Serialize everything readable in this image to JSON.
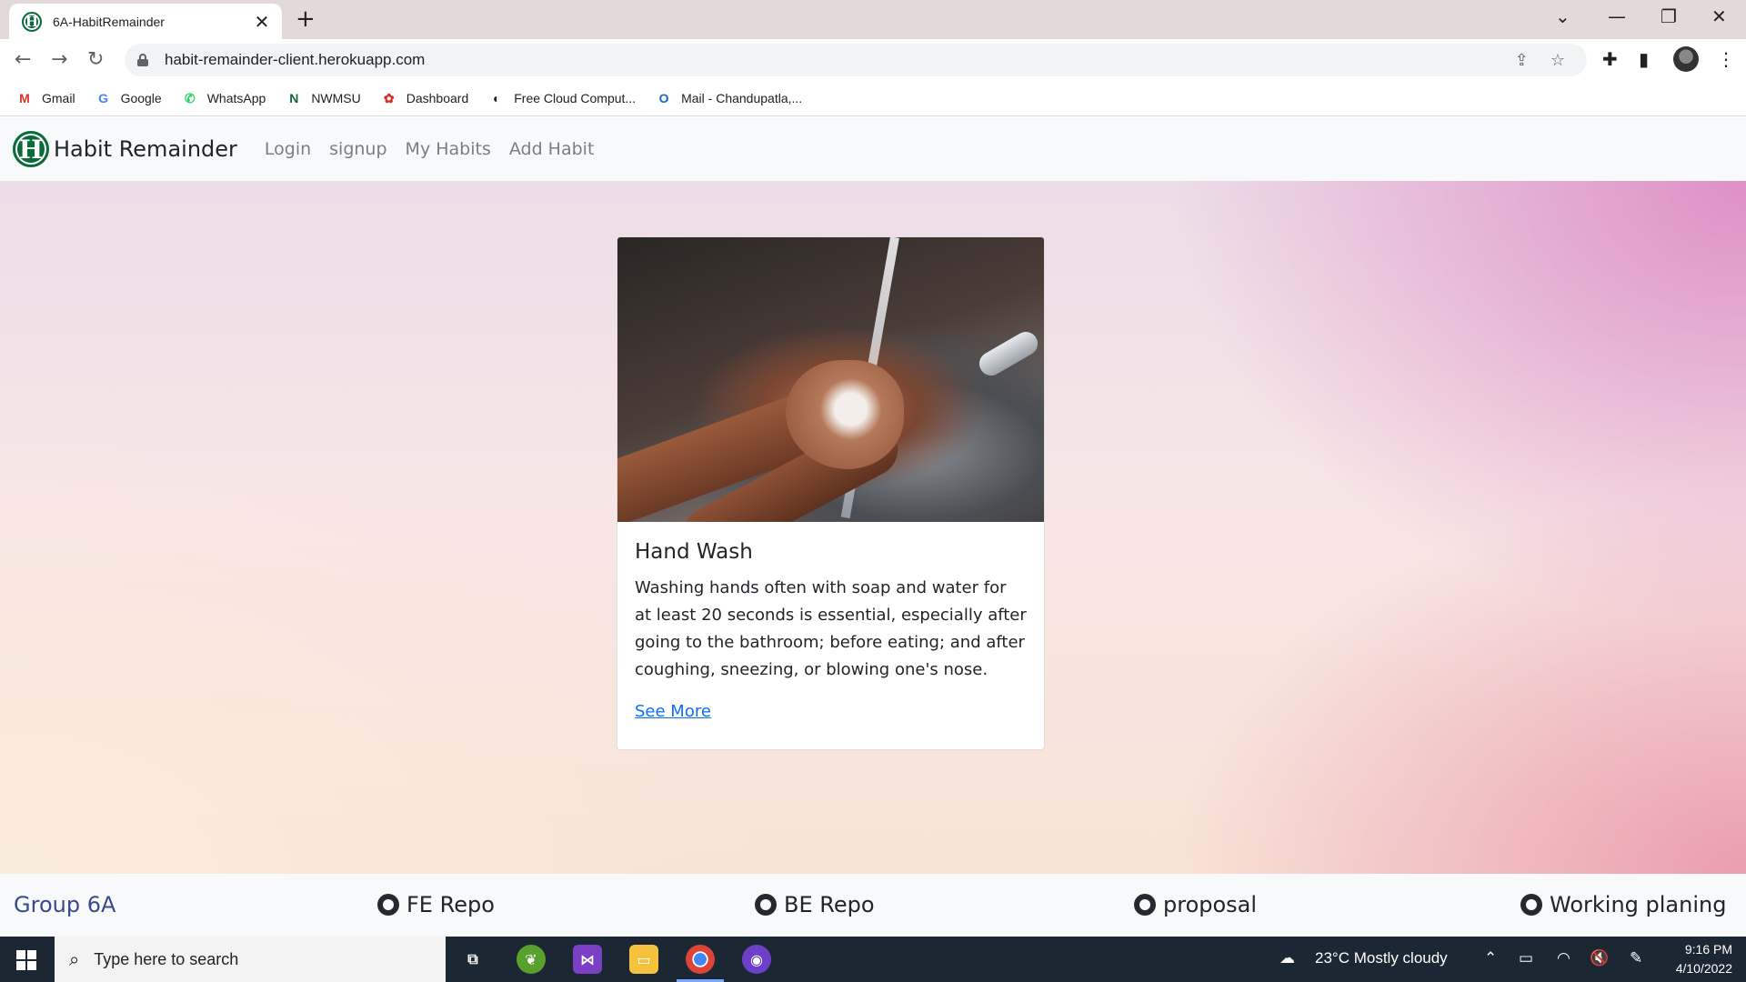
{
  "browser": {
    "tab_title": "6A-HabitRemainder",
    "tab_close": "✕",
    "new_tab": "+",
    "url": "habit-remainder-client.herokuapp.com",
    "bookmarks": [
      {
        "label": "Gmail",
        "icon": "gmail-icon",
        "glyph": "M",
        "color": "#d93025"
      },
      {
        "label": "Google",
        "icon": "google-icon",
        "glyph": "G",
        "color": "#4285f4"
      },
      {
        "label": "WhatsApp",
        "icon": "whatsapp-icon",
        "glyph": "✆",
        "color": "#25d366"
      },
      {
        "label": "NWMSU",
        "icon": "nwmsu-icon",
        "glyph": "N",
        "color": "#0b6a3a"
      },
      {
        "label": "Dashboard",
        "icon": "dashboard-icon",
        "glyph": "✿",
        "color": "#d93025"
      },
      {
        "label": "Free Cloud Comput...",
        "icon": "cloud-icon",
        "glyph": "◐",
        "color": "#202124"
      },
      {
        "label": "Mail - Chandupatla,...",
        "icon": "outlook-icon",
        "glyph": "O",
        "color": "#0f6cbd"
      }
    ]
  },
  "navbar": {
    "logo_letter": "H",
    "brand": "Habit Remainder",
    "links": [
      "Login",
      "signup",
      "My Habits",
      "Add Habit"
    ]
  },
  "card": {
    "title": "Hand Wash",
    "text": "Washing hands often with soap and water for at least 20 seconds is essential, especially after going to the bathroom; before eating; and after coughing, sneezing, or blowing one's nose.",
    "link": "See More"
  },
  "footer": {
    "group": "Group 6A",
    "links": [
      "FE Repo",
      "BE Repo",
      "proposal",
      "Working planing"
    ]
  },
  "taskbar": {
    "search_placeholder": "Type here to search",
    "weather": "23°C  Mostly cloudy",
    "time": "9:16 PM",
    "date": "4/10/2022"
  }
}
